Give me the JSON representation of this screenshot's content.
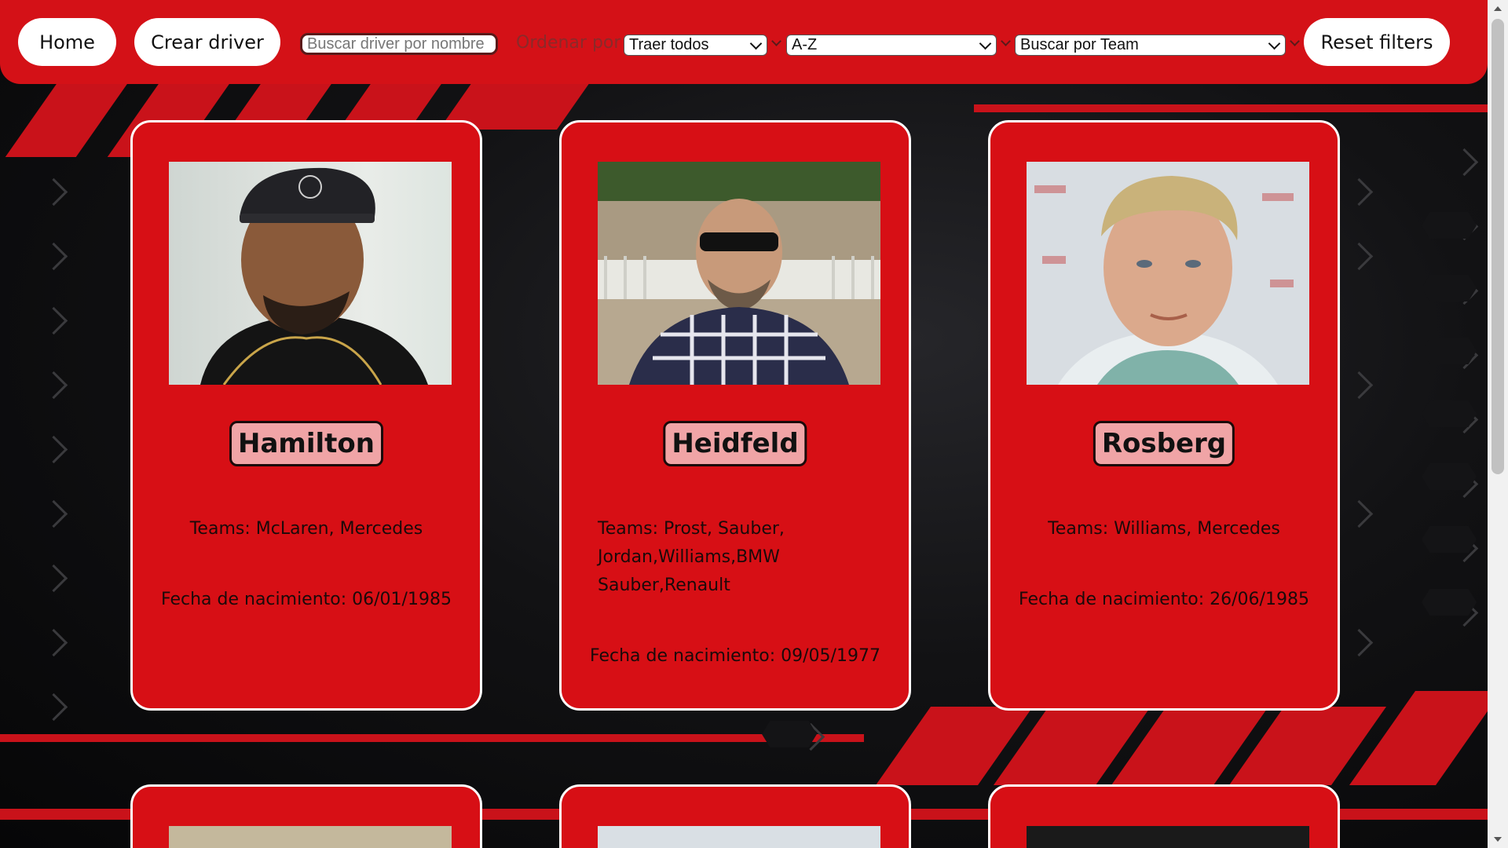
{
  "nav": {
    "home_label": "Home",
    "create_label": "Crear driver",
    "search_placeholder": "Buscar driver por nombre",
    "order_label": "Ordenar por",
    "fetch_select": "Traer todos",
    "sort_select": "A-Z",
    "team_select": "Buscar por Team",
    "reset_label": "Reset filters"
  },
  "drivers": [
    {
      "name": "Hamilton",
      "teams": "Teams: McLaren, Mercedes",
      "birth": "Fecha de nacimiento: 06/01/1985"
    },
    {
      "name": "Heidfeld",
      "teams": "Teams: Prost, Sauber, Jordan,Williams,BMW Sauber,Renault",
      "birth": "Fecha de nacimiento: 09/05/1977"
    },
    {
      "name": "Rosberg",
      "teams": "Teams: Williams, Mercedes",
      "birth": "Fecha de nacimiento: 26/06/1985"
    }
  ],
  "colors": {
    "brand_red": "#d41117",
    "card_red": "#d70f15",
    "name_badge": "#f0a4a6"
  }
}
